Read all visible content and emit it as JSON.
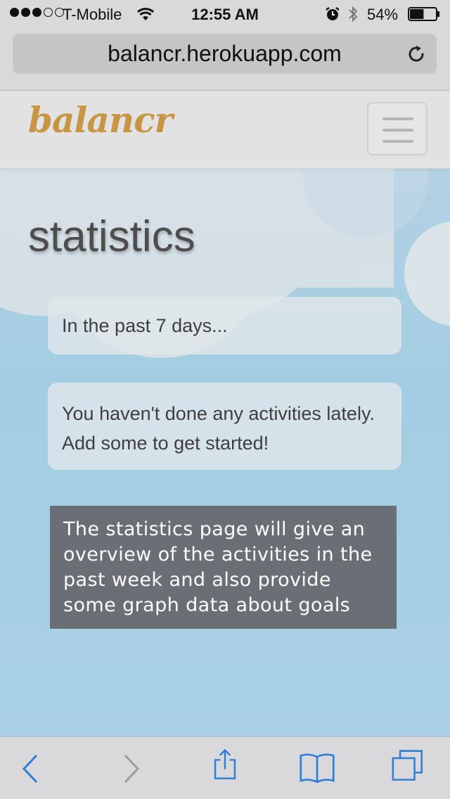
{
  "status_bar": {
    "carrier": "T-Mobile",
    "time": "12:55 AM",
    "battery_percent": "54%",
    "battery_level": 0.54,
    "signal_bars_filled": 3,
    "signal_bars_total": 5
  },
  "browser": {
    "url": "balancr.herokuapp.com"
  },
  "navbar": {
    "brand": "balancr"
  },
  "main": {
    "title": "statistics",
    "summary_text": "In the past 7 days...",
    "empty_message": "You haven't done any activities lately. Add some to get started!"
  },
  "annotation": {
    "text": "The statistics page will give an overview of the activities in the past week and also provide some graph data about goals"
  },
  "colors": {
    "brand": "#c89545",
    "ios_tint": "#2f7fd6",
    "annotation_bg": "#696f75",
    "sky": "#a9cfe4"
  },
  "icons": {
    "reload": "reload-icon",
    "back": "back-icon",
    "forward": "forward-icon",
    "share": "share-icon",
    "bookmarks": "bookmarks-icon",
    "tabs": "tabs-icon",
    "menu": "hamburger-icon"
  }
}
